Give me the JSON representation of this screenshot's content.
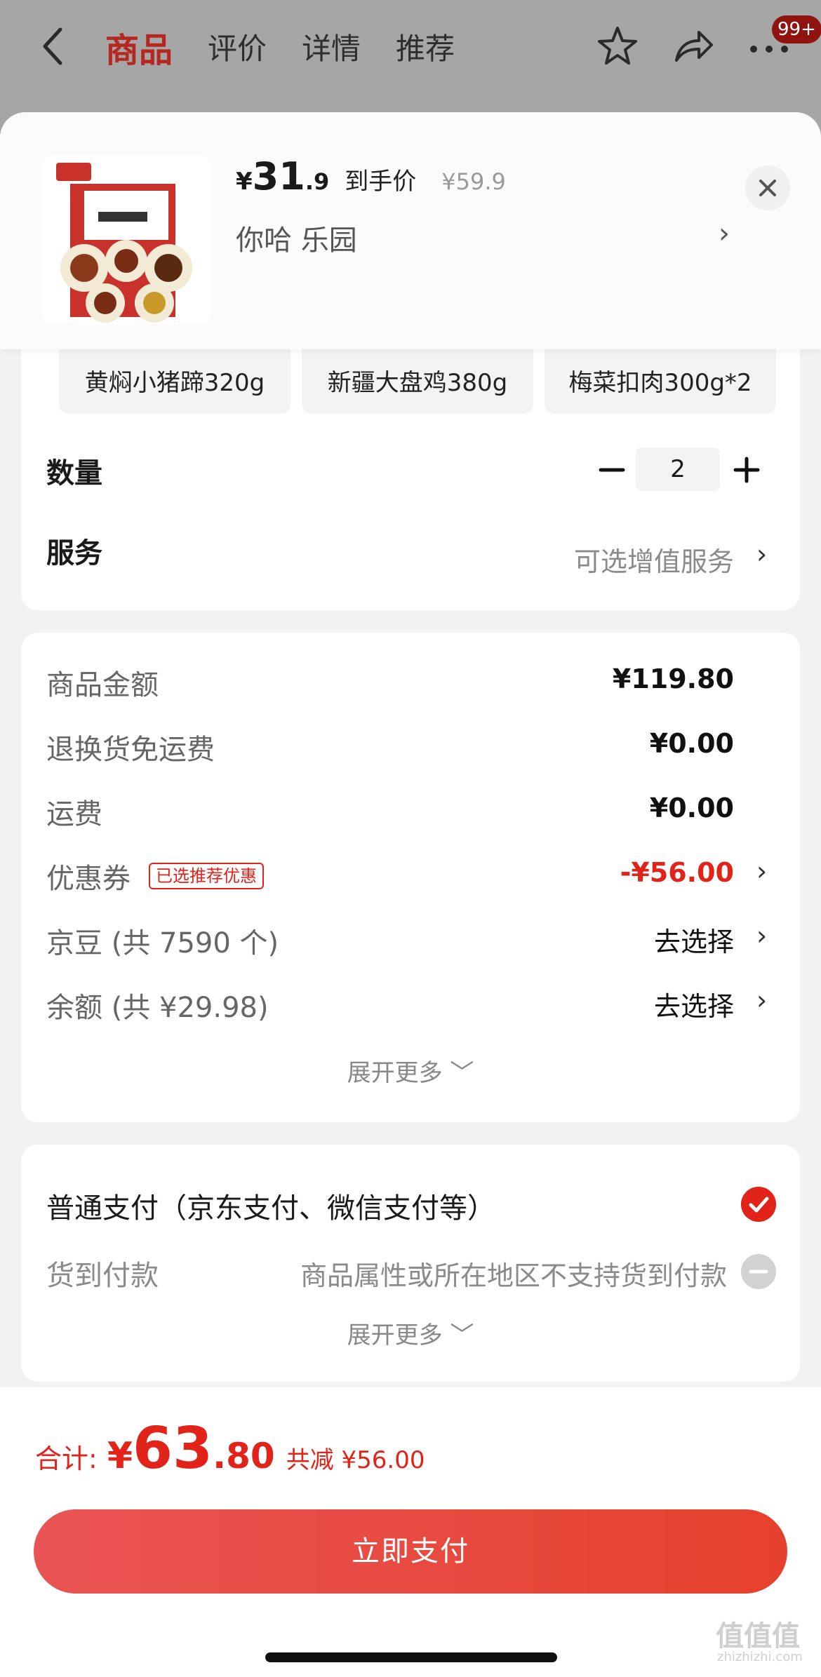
{
  "nav": {
    "tabs": [
      "商品",
      "评价",
      "详情",
      "推荐"
    ],
    "badge": "99+"
  },
  "product": {
    "price_yen": "¥",
    "price_int": "31",
    "price_dec": ".9",
    "price_tag": "到手价",
    "original_price": "¥59.9",
    "variant": "你哈  乐园",
    "variant_chevron": "›"
  },
  "options": [
    {
      "label": "黄焖小猪蹄320g"
    },
    {
      "label": "新疆大盘鸡380g"
    },
    {
      "label": "梅菜扣肉300g*2"
    }
  ],
  "quantity": {
    "label": "数量",
    "value": "2"
  },
  "service": {
    "label": "服务",
    "value": "可选增值服务"
  },
  "summary": {
    "goods_amount": {
      "label": "商品金额",
      "value": "¥119.80"
    },
    "return_shipping": {
      "label": "退换货免运费",
      "value": "¥0.00"
    },
    "shipping": {
      "label": "运费",
      "value": "¥0.00"
    },
    "coupon": {
      "label": "优惠券",
      "tag": "已选推荐优惠",
      "value": "-¥56.00"
    },
    "jingdou": {
      "label": "京豆 (共 7590 个)",
      "value": "去选择"
    },
    "balance": {
      "label": "余额 (共 ¥29.98)",
      "value": "去选择"
    },
    "expand": "展开更多 ﹀"
  },
  "payment": {
    "normal": "普通支付（京东支付、微信支付等）",
    "cod": "货到付款",
    "cod_note": "商品属性或所在地区不支持货到付款",
    "expand": "展开更多 ﹀"
  },
  "footer": {
    "total_label": "合计:",
    "total_yen": "¥",
    "total_int": "63",
    "total_dec": ".80",
    "saved": "共减 ¥56.00",
    "pay_button": "立即支付"
  },
  "watermark": {
    "logo": "值值值",
    "site": "zhizhizhi.com"
  },
  "colors": {
    "accent": "#e2231a",
    "nav_active": "#b5271f",
    "button_start": "#e95454",
    "button_end": "#e6412d"
  }
}
